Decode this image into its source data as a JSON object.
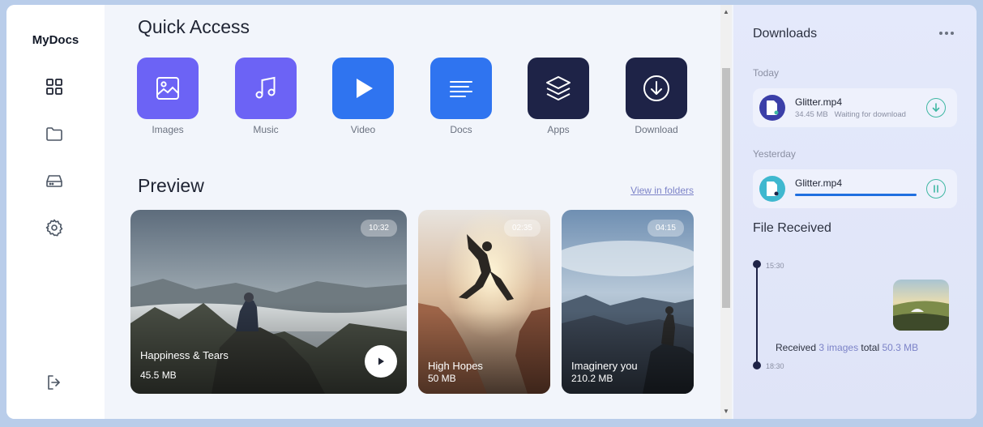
{
  "app": {
    "brand": "MyDocs"
  },
  "sidebar": {
    "items": [
      {
        "icon": "grid-icon"
      },
      {
        "icon": "folder-icon"
      },
      {
        "icon": "drive-icon"
      },
      {
        "icon": "gear-icon"
      },
      {
        "icon": "logout-icon"
      }
    ]
  },
  "quick_access": {
    "title": "Quick Access",
    "items": [
      {
        "label": "Images",
        "icon": "image-icon",
        "color": "#6c63f5"
      },
      {
        "label": "Music",
        "icon": "music-icon",
        "color": "#6c63f5"
      },
      {
        "label": "Video",
        "icon": "play-icon",
        "color": "#2f74f0"
      },
      {
        "label": "Docs",
        "icon": "docs-icon",
        "color": "#2f74f0"
      },
      {
        "label": "Apps",
        "icon": "layers-icon",
        "color": "#1e2347"
      },
      {
        "label": "Download",
        "icon": "download-icon",
        "color": "#1e2347"
      }
    ]
  },
  "preview": {
    "title": "Preview",
    "link": "View in folders",
    "cards": [
      {
        "title": "Happiness & Tears",
        "size": "45.5 MB",
        "duration": "10:32"
      },
      {
        "title": "High Hopes",
        "size": "50 MB",
        "duration": "02:35"
      },
      {
        "title": "Imaginery you",
        "size": "210.2 MB",
        "duration": "04:15"
      }
    ]
  },
  "downloads": {
    "title": "Downloads",
    "today_label": "Today",
    "yesterday_label": "Yesterday",
    "today_item": {
      "name": "Glitter.mp4",
      "size": "34.45 MB",
      "status": "Waiting for download"
    },
    "yesterday_item": {
      "name": "Glitter.mp4",
      "progress": 1.0
    }
  },
  "file_received": {
    "title": "File Received",
    "time_start": "15:30",
    "time_end": "18:30",
    "prefix": "Received",
    "count": "3 images",
    "mid": "total",
    "total": "50.3 MB"
  },
  "colors": {
    "accent_purple": "#6c63f5",
    "accent_blue": "#2f74f0",
    "dark_navy": "#1e2347",
    "teal": "#3fb8a3"
  }
}
